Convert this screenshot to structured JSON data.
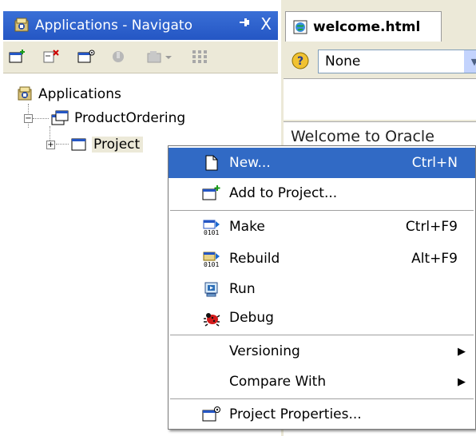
{
  "navigator": {
    "title": "Applications - Navigato",
    "pin_glyph": "←",
    "close_glyph": "X",
    "tree": {
      "root": "Applications",
      "app": "ProductOrdering",
      "project": "Project",
      "expand_minus": "−",
      "expand_plus": "+"
    }
  },
  "editor": {
    "tab_label": "welcome.html",
    "dropdown_value": "None",
    "dropdown_arrow": "▼",
    "content_text": "Welcome to Oracle"
  },
  "context_menu": {
    "items": [
      {
        "label": "New...",
        "shortcut": "Ctrl+N",
        "icon": "new-file-icon"
      },
      {
        "label": "Add to Project...",
        "shortcut": "",
        "icon": "add-to-project-icon"
      },
      {
        "label": "Make",
        "shortcut": "Ctrl+F9",
        "icon": "make-icon"
      },
      {
        "label": "Rebuild",
        "shortcut": "Alt+F9",
        "icon": "rebuild-icon"
      },
      {
        "label": "Run",
        "shortcut": "",
        "icon": "run-icon"
      },
      {
        "label": "Debug",
        "shortcut": "",
        "icon": "debug-bug-icon"
      },
      {
        "label": "Versioning",
        "shortcut": "",
        "icon": ""
      },
      {
        "label": "Compare With",
        "shortcut": "",
        "icon": ""
      },
      {
        "label": "Project Properties...",
        "shortcut": "",
        "icon": "project-properties-icon"
      }
    ],
    "submenu_arrow": "▶"
  },
  "colors": {
    "titlebar": "#2456c4",
    "highlight": "#316ac5",
    "chrome": "#ece9d8"
  }
}
